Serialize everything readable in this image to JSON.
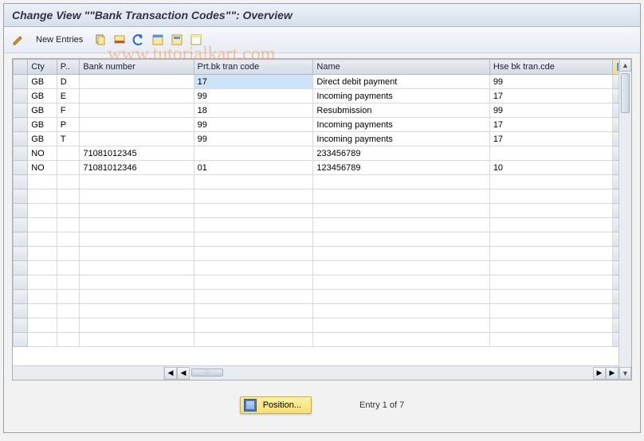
{
  "title": "Change View \"\"Bank Transaction Codes\"\": Overview",
  "watermark": "www.tutorialkart.com",
  "toolbar": {
    "new_entries": "New Entries"
  },
  "columns": {
    "cty": "Cty",
    "p": "P..",
    "bank": "Bank number",
    "prt": "Prt.bk tran code",
    "name": "Name",
    "hse": "Hse bk tran.cde"
  },
  "rows": [
    {
      "cty": "GB",
      "p": "D",
      "bank": "",
      "prt": "17",
      "name": "Direct debit payment",
      "hse": "99",
      "hl": true
    },
    {
      "cty": "GB",
      "p": "E",
      "bank": "",
      "prt": "99",
      "name": "Incoming payments",
      "hse": "17"
    },
    {
      "cty": "GB",
      "p": "F",
      "bank": "",
      "prt": "18",
      "name": "Resubmission",
      "hse": "99"
    },
    {
      "cty": "GB",
      "p": "P",
      "bank": "",
      "prt": "99",
      "name": "Incoming payments",
      "hse": "17"
    },
    {
      "cty": "GB",
      "p": "T",
      "bank": "",
      "prt": "99",
      "name": "Incoming payments",
      "hse": "17"
    },
    {
      "cty": "NO",
      "p": "",
      "bank": "71081012345",
      "prt": "",
      "name": "233456789",
      "hse": ""
    },
    {
      "cty": "NO",
      "p": "",
      "bank": "71081012346",
      "prt": "01",
      "name": "123456789",
      "hse": "10"
    }
  ],
  "footer": {
    "position_label": "Position...",
    "entry_text": "Entry 1 of 7"
  }
}
